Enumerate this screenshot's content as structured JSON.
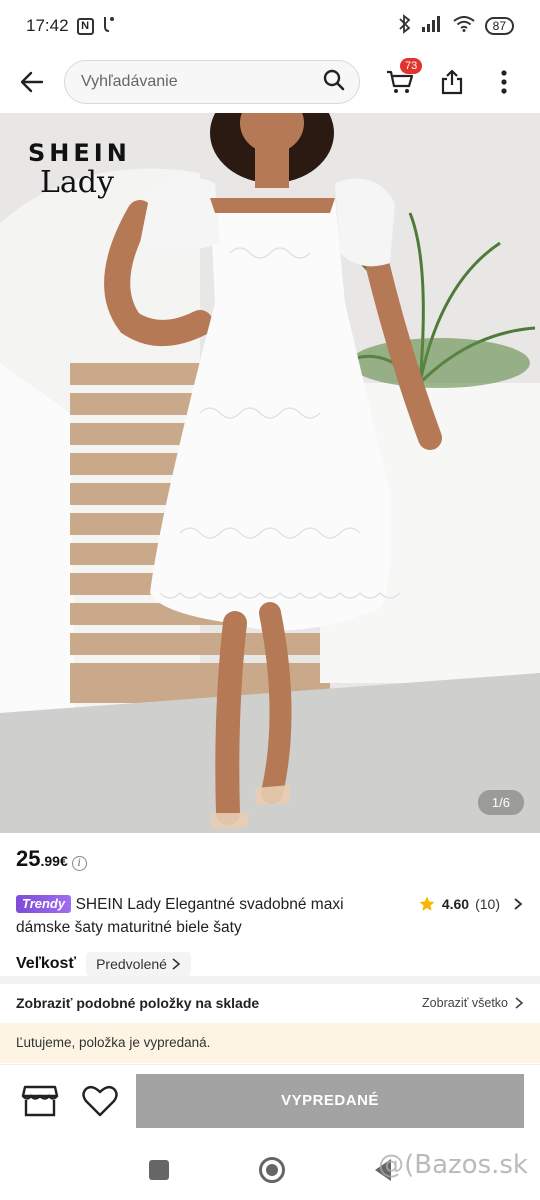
{
  "status_bar": {
    "time": "17:42",
    "nfc_label": "N",
    "battery": "87"
  },
  "nav": {
    "search_placeholder": "Vyhľadávanie",
    "cart_count": "73"
  },
  "gallery": {
    "brand_line1": "SHEIN",
    "brand_line2": "Lady",
    "counter": "1/6"
  },
  "product": {
    "price_main": "25",
    "price_decimals": ".99€",
    "badge": "Trendy",
    "title": "SHEIN Lady Elegantné svadobné maxi dámske šaty maturitné biele šaty",
    "rating": "4.60",
    "rating_count": "(10)",
    "size_label": "Veľkosť",
    "size_value": "Predvolené"
  },
  "similar": {
    "title": "Zobraziť podobné položky na sklade",
    "link": "Zobraziť všetko"
  },
  "notice": "Ľutujeme, položka je vypredaná.",
  "actions": {
    "soldout_label": "VYPREDANÉ"
  },
  "watermark": "@(Bazos.sk",
  "colors": {
    "badge_purple": "#8a57e0",
    "cart_badge_red": "#e0342f",
    "star": "#f5b800",
    "soldout_btn": "#a3a3a3",
    "notice_bg": "#fdf4e3"
  }
}
